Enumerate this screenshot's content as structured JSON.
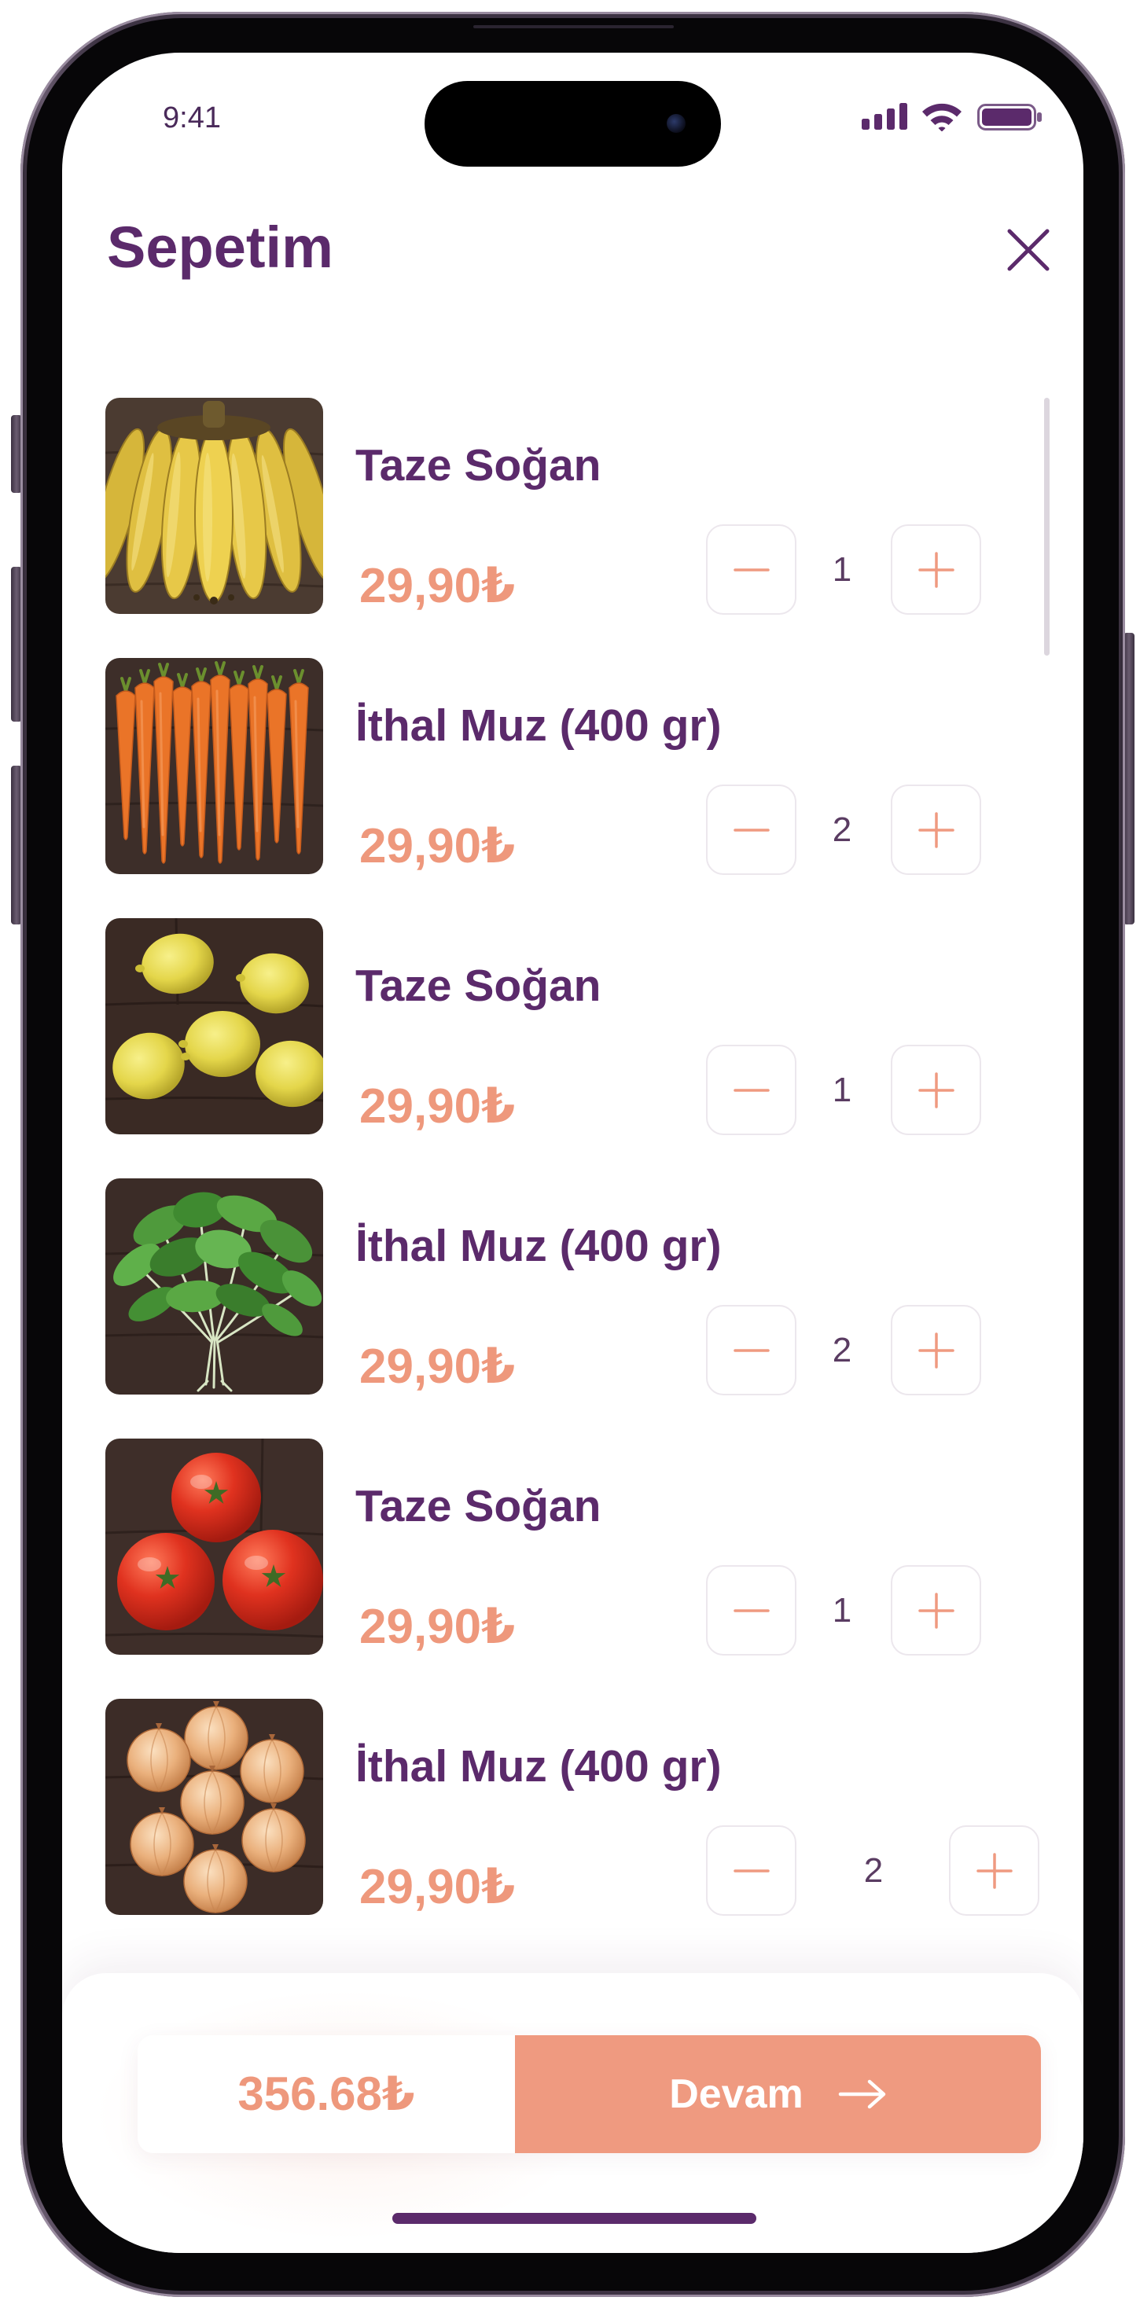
{
  "status_bar": {
    "time": "9:41",
    "icons": [
      "cellular-signal-icon",
      "wifi-icon",
      "battery-icon"
    ]
  },
  "header": {
    "title": "Sepetim",
    "close_icon": "close-icon"
  },
  "cart": {
    "items": [
      {
        "name": "Taze Soğan",
        "price": "29,90₺",
        "quantity": 1,
        "image": "bananas-photo"
      },
      {
        "name": "İthal Muz (400 gr)",
        "price": "29,90₺",
        "quantity": 2,
        "image": "carrots-photo"
      },
      {
        "name": "Taze Soğan",
        "price": "29,90₺",
        "quantity": 1,
        "image": "lemons-photo"
      },
      {
        "name": "İthal Muz (400 gr)",
        "price": "29,90₺",
        "quantity": 2,
        "image": "greens-photo"
      },
      {
        "name": "Taze Soğan",
        "price": "29,90₺",
        "quantity": 1,
        "image": "tomatoes-photo"
      },
      {
        "name": "İthal Muz (400 gr)",
        "price": "29,90₺",
        "quantity": 2,
        "image": "onions-photo"
      }
    ],
    "stepper": {
      "decrement_icon": "minus-icon",
      "increment_icon": "plus-icon"
    }
  },
  "footer": {
    "total": "356.68₺",
    "continue_label": "Devam",
    "continue_icon": "arrow-right-icon"
  },
  "colors": {
    "primary": "#5b2a6b",
    "accent": "#ef9a80",
    "price": "#ee987c"
  }
}
